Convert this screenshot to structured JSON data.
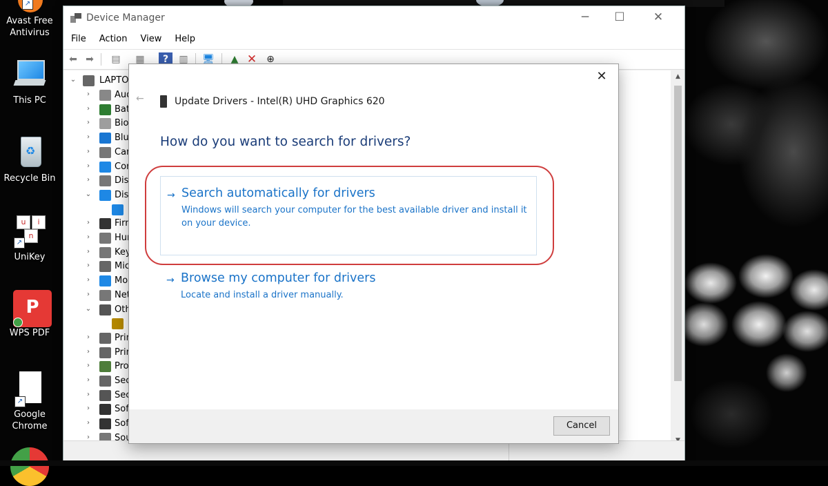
{
  "desktop": {
    "icons": [
      {
        "label": "Avast Free\nAntivirus",
        "icon": "avast-icon"
      },
      {
        "label": "This PC",
        "icon": "computer-icon"
      },
      {
        "label": "Recycle Bin",
        "icon": "recycle-bin-icon"
      },
      {
        "label": "UniKey",
        "icon": "unikey-icon"
      },
      {
        "label": "WPS PDF",
        "icon": "wps-pdf-icon"
      },
      {
        "label": "Google\nChrome",
        "icon": "chrome-icon"
      }
    ]
  },
  "device_manager": {
    "title": "Device Manager",
    "menu": [
      "File",
      "Action",
      "View",
      "Help"
    ],
    "tree": {
      "root": "LAPTOP",
      "items": [
        "Aud",
        "Batt",
        "Bion",
        "Blue",
        "Can",
        "Con",
        "Disk",
        "Disp",
        "",
        "Firm",
        "Hun",
        "Key",
        "Mic",
        "Mo",
        "Net",
        "Oth",
        "",
        "Prin",
        "Prin",
        "Proc",
        "Sec",
        "Sec",
        "Soft",
        "Soft",
        "Sou"
      ]
    }
  },
  "update_drivers": {
    "title": "Update Drivers - Intel(R) UHD Graphics 620",
    "question": "How do you want to search for drivers?",
    "option_auto": {
      "title": "Search automatically for drivers",
      "description": "Windows will search your computer for the best available driver and install it on your device."
    },
    "option_browse": {
      "title": "Browse my computer for drivers",
      "description": "Locate and install a driver manually."
    },
    "cancel_label": "Cancel",
    "close_label": "✕",
    "arrow_glyph": "→",
    "highlight_color": "#cf3d3d",
    "link_color": "#1a73c8"
  }
}
